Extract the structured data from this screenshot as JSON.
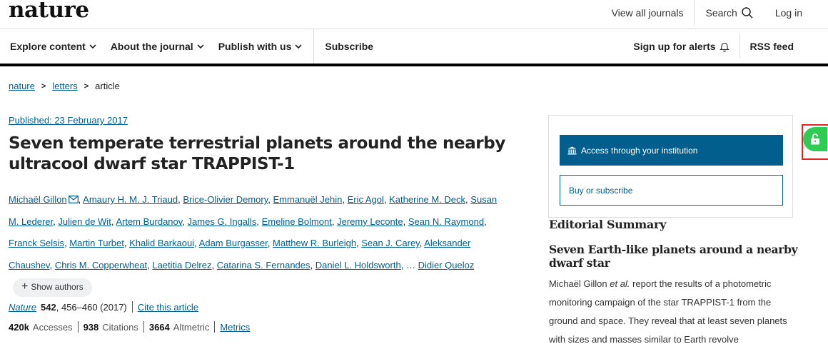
{
  "brand": {
    "logo": "nature"
  },
  "top_links": {
    "view_all": "View all journals",
    "search": "Search",
    "login": "Log in"
  },
  "nav": {
    "explore": "Explore content",
    "about": "About the journal",
    "publish": "Publish with us",
    "subscribe": "Subscribe",
    "alerts": "Sign up for alerts",
    "rss": "RSS feed"
  },
  "breadcrumb": {
    "items": [
      "nature",
      "letters",
      "article"
    ]
  },
  "article": {
    "published": "Published: 23 February 2017",
    "title": "Seven temperate terrestrial planets around the nearby ultracool dwarf star TRAPPIST-1",
    "authors": [
      "Michaël Gillon",
      "Amaury H. M. J. Triaud",
      "Brice-Olivier Demory",
      "Emmanuël Jehin",
      "Eric Agol",
      "Katherine M. Deck",
      "Susan M. Lederer",
      "Julien de Wit",
      "Artem Burdanov",
      "James G. Ingalls",
      "Emeline Bolmont",
      "Jeremy Leconte",
      "Sean N. Raymond",
      "Franck Selsis",
      "Martin Turbet",
      "Khalid Barkaoui",
      "Adam Burgasser",
      "Matthew R. Burleigh",
      "Sean J. Carey",
      "Aleksander Chaushev",
      "Chris M. Copperwheat",
      "Laetitia Delrez",
      "Catarina S. Fernandes",
      "Daniel L. Holdsworth",
      "Didier Queloz"
    ],
    "ellipsis": "…",
    "show_authors": "Show authors",
    "journal": "Nature",
    "volume": "542",
    "pages": ", 456–460 (2017)",
    "cite": "Cite this article",
    "accesses_value": "420k",
    "accesses_label": "Accesses",
    "citations_value": "938",
    "citations_label": "Citations",
    "altmetric_value": "3664",
    "altmetric_label": "Altmetric",
    "metrics": "Metrics"
  },
  "access": {
    "institution": "Access through your institution",
    "buy": "Buy or subscribe"
  },
  "editorial": {
    "heading": "Editorial Summary",
    "subheading": "Seven Earth-like planets around a nearby dwarf star",
    "body_author": "Michaël Gillon",
    "body_etal": "et al.",
    "body_text": " report the results of a photometric monitoring campaign of the star TRAPPIST-1 from the ground and space. They reveal that at least seven planets with sizes and masses similar to Earth revolve"
  },
  "colors": {
    "link": "#025e8d",
    "primary_button": "#025e8d",
    "lock_green": "#2ecc52",
    "highlight_red": "#e02424"
  },
  "icons": [
    "search-icon",
    "chevron-down-icon",
    "bell-icon",
    "mail-icon",
    "plus-icon",
    "institution-icon",
    "unlock-icon"
  ]
}
